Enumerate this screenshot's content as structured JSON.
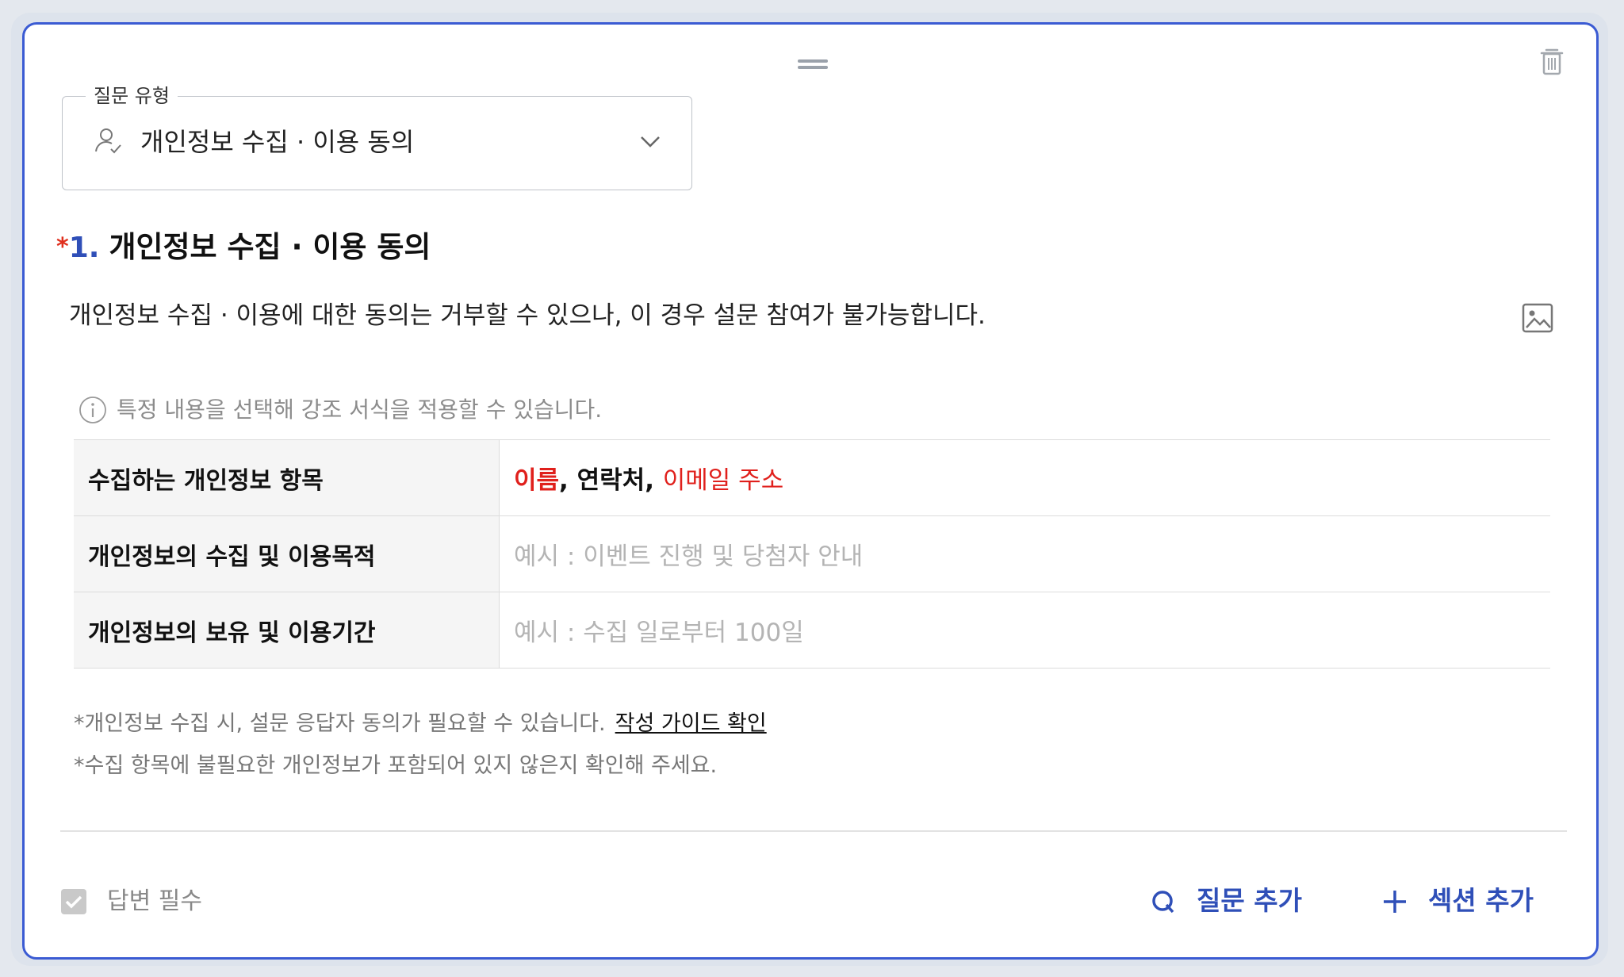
{
  "question_type": {
    "legend": "질문 유형",
    "value": "개인정보 수집 · 이용 동의"
  },
  "question": {
    "required_mark": "*",
    "number": "1.",
    "title": "개인정보 수집 · 이용 동의",
    "description": "개인정보 수집 · 이용에 대한 동의는 거부할 수 있으나, 이 경우 설문 참여가 불가능합니다."
  },
  "info_text": "특정 내용을 선택해 강조 서식을 적용할 수 있습니다.",
  "table": {
    "row1": {
      "label": "수집하는 개인정보 항목",
      "item1": "이름",
      "sep1": ", ",
      "item2": "연락처",
      "sep2": ", ",
      "item3": "이메일 주소"
    },
    "row2": {
      "label": "개인정보의 수집 및 이용목적",
      "placeholder": "예시 : 이벤트 진행 및 당첨자 안내"
    },
    "row3": {
      "label": "개인정보의 보유 및 이용기간",
      "placeholder": "예시 : 수집 일로부터 100일"
    }
  },
  "notes": {
    "note1": "*개인정보 수집 시, 설문 응답자 동의가 필요할 수 있습니다.",
    "guide_link": "작성 가이드 확인",
    "note2": "*수집 항목에 불필요한 개인정보가 포함되어 있지 않은지 확인해 주세요."
  },
  "footer": {
    "required_label": "답변 필수",
    "required_checked": true,
    "add_question": "질문 추가",
    "add_section": "섹션 추가"
  },
  "colors": {
    "accent_blue": "#2f4fb8",
    "card_border": "#3b5bd3",
    "highlight_red": "#e0201c",
    "placeholder_gray": "#b4b4b4"
  },
  "icons": {
    "drag": "drag-handle-icon",
    "delete": "trash-icon",
    "type": "person-check-icon",
    "dropdown": "chevron-down-icon",
    "image": "image-icon",
    "info": "info-icon",
    "checkbox": "checkbox-icon",
    "add_question": "q-icon",
    "add_section": "plus-icon"
  }
}
